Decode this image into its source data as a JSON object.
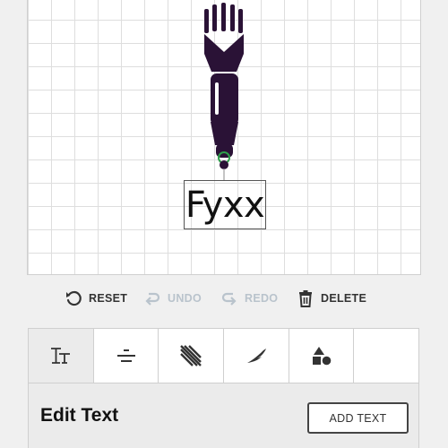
{
  "canvas": {
    "text_layer": "Fyxx",
    "design_color": "#2a1236",
    "handle_color": "#2e9e4a"
  },
  "toolbar": {
    "reset_label": "RESET",
    "undo_label": "UNDO",
    "redo_label": "REDO",
    "delete_label": "DELETE",
    "undo_enabled": false,
    "redo_enabled": false
  },
  "tabs": [
    {
      "icon": "text-style-icon",
      "active": true
    },
    {
      "icon": "align-center-icon",
      "active": false
    },
    {
      "icon": "stripes-pattern-icon",
      "active": false
    },
    {
      "icon": "brush-stroke-icon",
      "active": false
    },
    {
      "icon": "shapes-icon",
      "active": false
    },
    {
      "icon": "",
      "active": false
    }
  ],
  "panel": {
    "title": "Edit Text",
    "add_text_label": "ADD TEXT"
  }
}
